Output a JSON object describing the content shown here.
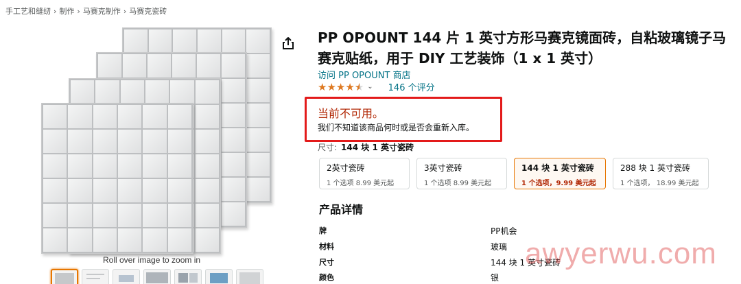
{
  "breadcrumb": [
    "手工艺和缝纫",
    "制作",
    "马赛克制作",
    "马赛克瓷砖"
  ],
  "breadcrumb_sep": "›",
  "product": {
    "title": "PP OPOUNT 144 片 1 英寸方形马赛克镜面砖，自粘玻璃镜子马赛克贴纸，用于 DIY 工艺装饰（1 x 1 英寸）",
    "store_link": "访问 PP OPOUNT 商店",
    "rating_stars": 4.5,
    "reviews": "146 个评分"
  },
  "availability": {
    "title": "当前不可用。",
    "subtitle": "我们不知道该商品何时或是否会重新入库。",
    "highlight_color": "#e31a1a"
  },
  "size": {
    "label": "尺寸:",
    "selected": "144 块 1 英寸瓷砖",
    "options": [
      {
        "name": "2英寸瓷砖",
        "price": "1 个选项 8.99 美元起",
        "selected": false
      },
      {
        "name": "3英寸瓷砖",
        "price": "1 个选项 8.99 美元起",
        "selected": false
      },
      {
        "name": "144 块 1 英寸瓷砖",
        "price": "1 个选项，9.99 美元起",
        "selected": true
      },
      {
        "name": "288 块 1 英寸瓷砖",
        "price": "1 个选项， 18.99 美元起",
        "selected": false
      }
    ]
  },
  "details": {
    "heading": "产品详情",
    "rows": [
      {
        "key": "牌",
        "value": "PP机会"
      },
      {
        "key": "材料",
        "value": "玻璃"
      },
      {
        "key": "尺寸",
        "value": "144 块 1 英寸瓷砖"
      },
      {
        "key": "颜色",
        "value": "银"
      }
    ]
  },
  "gallery": {
    "zoom_hint": "Roll over image to zoom in",
    "thumbnail_count": 7,
    "share_icon": "share-icon"
  },
  "watermark": "awyerwu.com",
  "colors": {
    "link": "#007185",
    "star": "#de7921",
    "unavailable": "#b12704",
    "selected_border": "#e77600"
  }
}
